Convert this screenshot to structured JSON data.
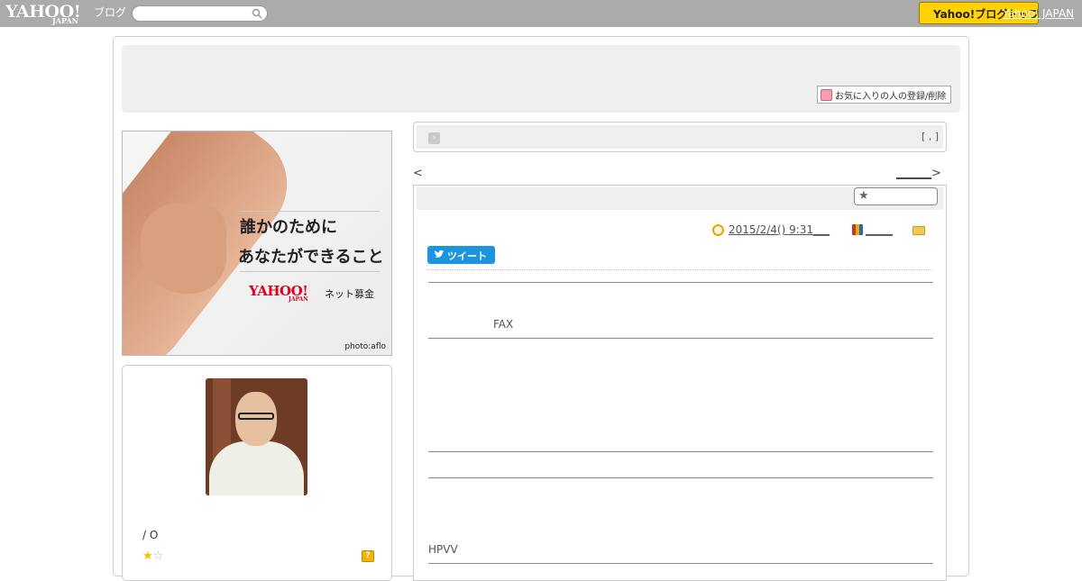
{
  "topbar": {
    "logo_text": "YAHOO!",
    "logo_sub": "JAPAN",
    "logo_service": "ブログ",
    "search_placeholder": "",
    "yj_button_label": "Yahoo!ブログトップ",
    "yj_link_label": "Yahoo! JAPAN"
  },
  "header": {
    "fav_button_label": "お気に入りの人の登録/削除"
  },
  "banner": {
    "line1": "誰かのために",
    "line2": "あなたができること",
    "brand": "YAHOO!",
    "brand_sub": "JAPAN",
    "brand_service": "ネット募金",
    "credit": "photo:aflo"
  },
  "profile": {
    "nickname": "/ O",
    "stars": [
      "★",
      "☆"
    ],
    "help_label": "?"
  },
  "category_bar": {
    "bracket_text": "[ , ]"
  },
  "nav": {
    "prev": "<",
    "next_text": "______",
    "next_arrow": ">"
  },
  "article": {
    "date": "2015/2/4()  9:31___",
    "theme": "_____",
    "tweet_label": "ツイート",
    "text_fax": "FAX",
    "text_hpvv": "HPVV"
  },
  "colors": {
    "topbar": "#ababab",
    "yj_button": "#ffd200",
    "tweet": "#1b95e0",
    "panel": "#efefef"
  }
}
